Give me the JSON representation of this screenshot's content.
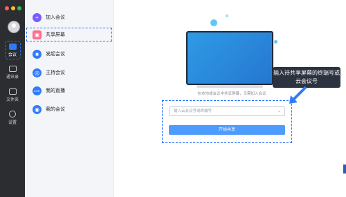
{
  "window": {
    "traffic_lights": [
      "#ff5f57",
      "#ffbd2e",
      "#28c840"
    ]
  },
  "rail": {
    "items": [
      {
        "label": "会议",
        "active": true
      },
      {
        "label": "通讯录",
        "active": false
      },
      {
        "label": "文件夹",
        "active": false
      },
      {
        "label": "设置",
        "active": false
      }
    ]
  },
  "menu": {
    "items": [
      {
        "label": "加入会议",
        "color": "#7b5cff",
        "glyph": "+"
      },
      {
        "label": "共享屏幕",
        "color": "#ff6b8a",
        "glyph": "▣"
      },
      {
        "label": "发起会议",
        "color": "#2f7bff",
        "glyph": "■"
      },
      {
        "label": "主持会议",
        "color": "#2f7bff",
        "glyph": "◎"
      },
      {
        "label": "我的直播",
        "color": "#2f7bff",
        "glyph": "LIVE"
      },
      {
        "label": "我的会议",
        "color": "#2f7bff",
        "glyph": "◉"
      }
    ]
  },
  "main": {
    "hint": "在本地或会议中共享屏幕，无需加入会议",
    "input_placeholder": "输入云会议号或终端号",
    "start_button": "开始共享",
    "callout": "输入待共享屏幕的终端号或云会议号"
  }
}
